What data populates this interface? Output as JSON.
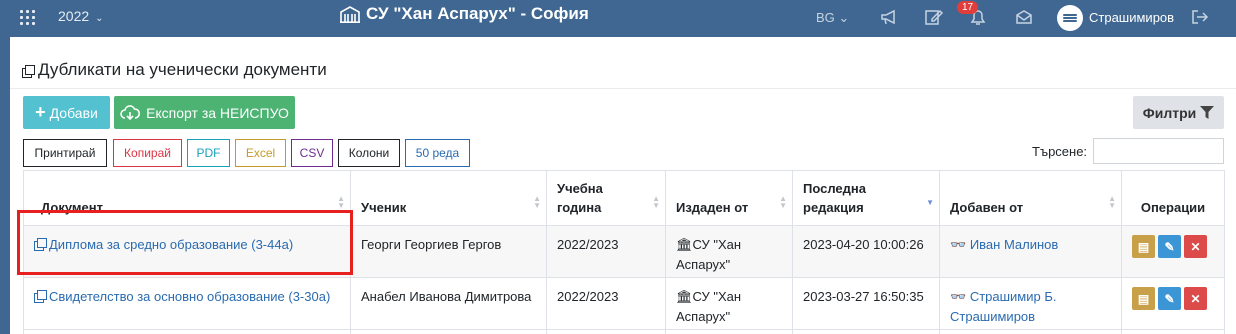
{
  "topbar": {
    "year": "2022",
    "school": "СУ \"Хан Аспарух\" - София",
    "lang": "BG",
    "notifications_count": "17",
    "user": "Страшимиров",
    "icons": [
      "grid-icon",
      "megaphone-icon",
      "edit-icon",
      "bell-icon",
      "envelope-icon",
      "logout-icon"
    ]
  },
  "page": {
    "title": "Дубликати на ученически документи"
  },
  "toolbar": {
    "add_label": "Добави",
    "export_label": "Експорт за НЕИСПУО",
    "filter_label": "Филтри"
  },
  "dt_buttons": [
    {
      "label": "Принтирай",
      "color": "#212529"
    },
    {
      "label": "Копирай",
      "color": "#dc3545"
    },
    {
      "label": "PDF",
      "color": "#17a2b8"
    },
    {
      "label": "Excel",
      "color": "#c49a2a"
    },
    {
      "label": "CSV",
      "color": "#6f2c91"
    },
    {
      "label": "Колони",
      "color": "#212529"
    },
    {
      "label": "50 реда",
      "color": "#2a6bb0"
    }
  ],
  "search": {
    "label": "Търсене:",
    "value": ""
  },
  "table": {
    "headers": [
      "Документ",
      "Ученик",
      "Учебна година",
      "Издаден от",
      "Последна редакция",
      "Добавен от",
      "Операции"
    ],
    "rows": [
      {
        "document": "Диплома за средно образование (3-44а)",
        "student": "Георги Георгиев Гергов",
        "year": "2022/2023",
        "issued_by": "СУ \"Хан Аспарух\"",
        "last_edit": "2023-04-20 10:00:26",
        "added_by": "Иван Малинов"
      },
      {
        "document": "Свидетелство за основно образование (3-30а)",
        "student": "Анабел Иванова Димитрова",
        "year": "2022/2023",
        "issued_by": "СУ \"Хан Аспарух\"",
        "last_edit": "2023-03-27 16:50:35",
        "added_by": "Страшимир Б. Страшимиров"
      }
    ]
  },
  "colors": {
    "navbar": "#3f6791",
    "add_button": "#53c1cf",
    "export_button": "#4cb373",
    "link": "#2a6bb0",
    "highlight": "#e81f1f"
  }
}
